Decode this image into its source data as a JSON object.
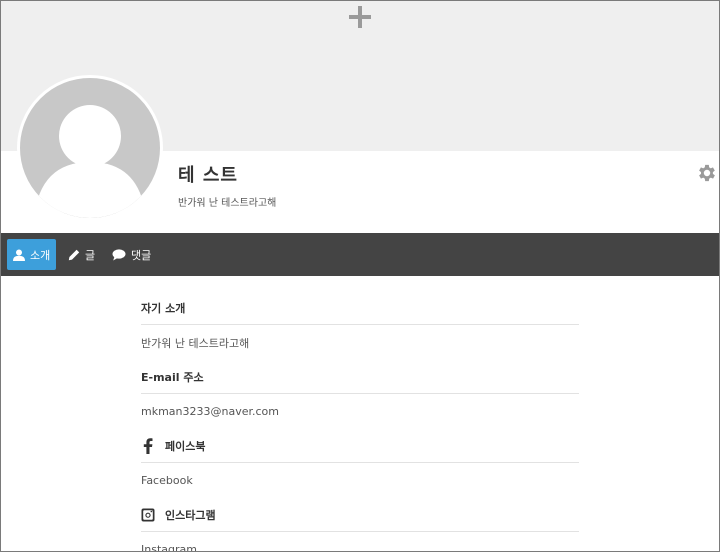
{
  "profile": {
    "name": "테 스트",
    "bio": "반가워 난 테스트라고해"
  },
  "tabs": [
    {
      "label": "소개",
      "icon": "user-icon",
      "active": true
    },
    {
      "label": "글",
      "icon": "pencil-icon",
      "active": false
    },
    {
      "label": "댓글",
      "icon": "comment-icon",
      "active": false
    }
  ],
  "sections": [
    {
      "title": "자기 소개",
      "value": "반가워 난 테스트라고해"
    },
    {
      "title": "E-mail 주소",
      "value": "mkman3233@naver.com"
    },
    {
      "title": "페이스북",
      "icon": "facebook-icon",
      "value": "Facebook"
    },
    {
      "title": "인스타그램",
      "icon": "instagram-icon",
      "value": "Instagram"
    }
  ],
  "colors": {
    "cover": "#efefef",
    "tabbar": "#444444",
    "active_tab": "#3d9fdb",
    "avatar": "#c8c8c8"
  }
}
